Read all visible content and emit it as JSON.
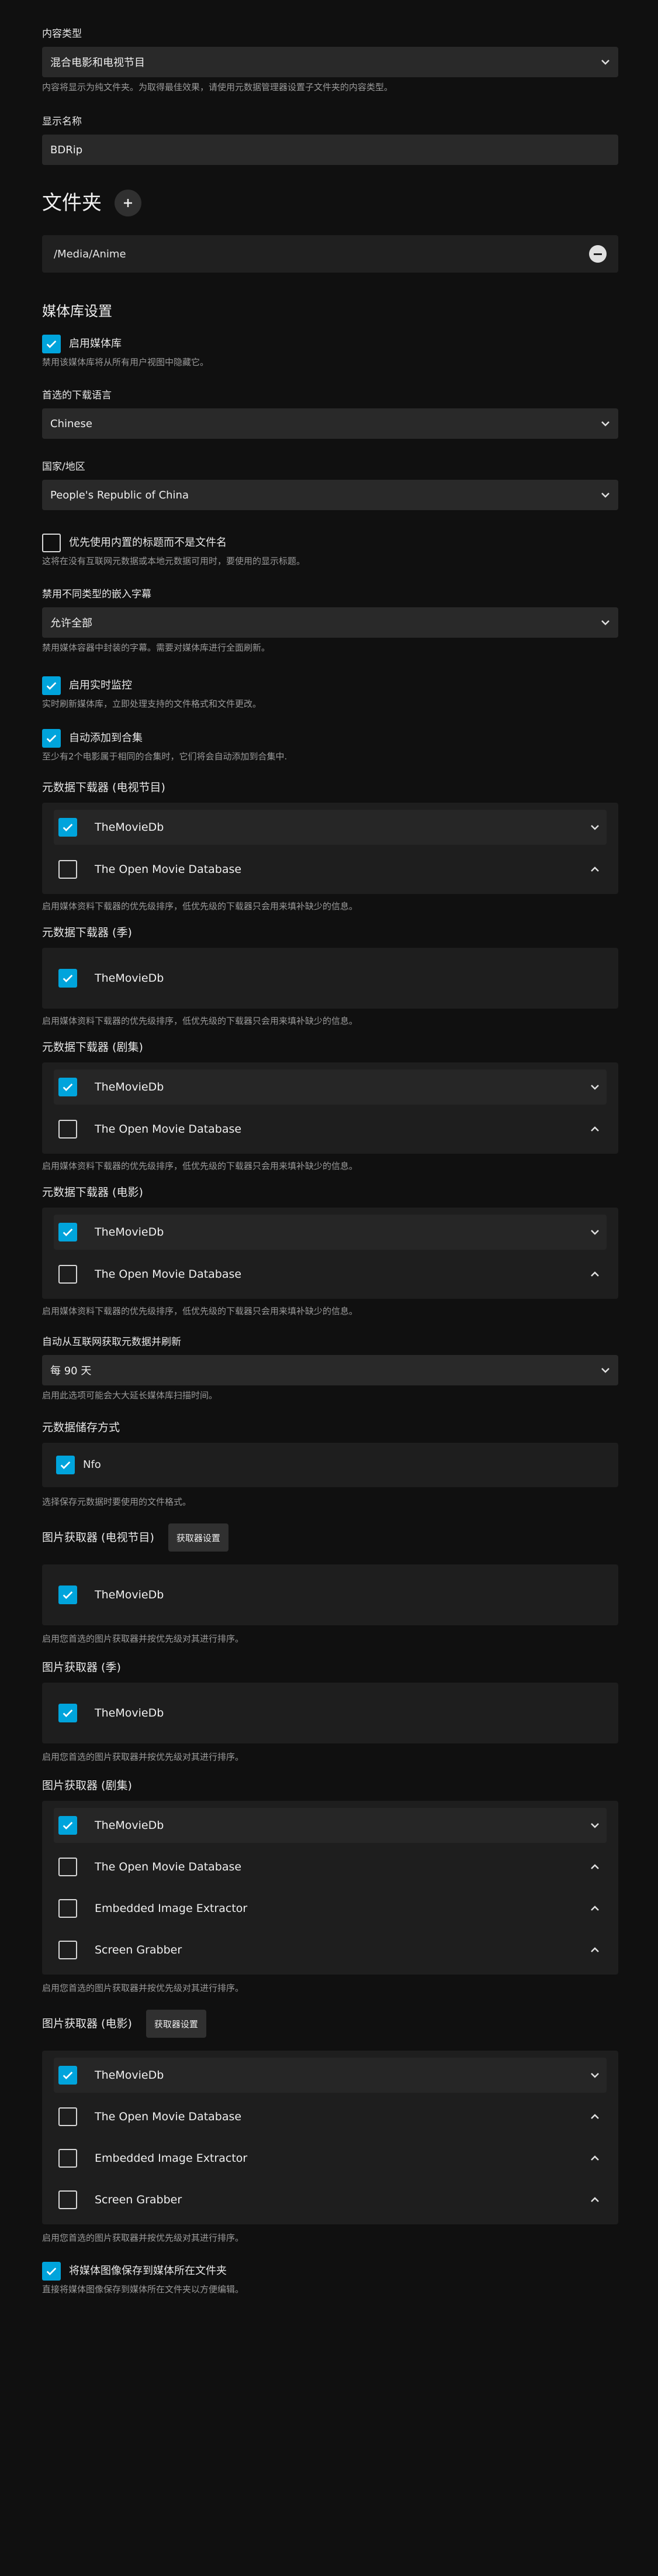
{
  "content_type": {
    "label": "内容类型",
    "value": "混合电影和电视节目",
    "help": "内容将显示为纯文件夹。为取得最佳效果，请使用元数据管理器设置子文件夹的内容类型。"
  },
  "display_name": {
    "label": "显示名称",
    "value": "BDRip"
  },
  "folders": {
    "title": "文件夹",
    "add_icon": "plus-icon",
    "items": [
      {
        "path": "/Media/Anime"
      }
    ]
  },
  "library_settings": {
    "title": "媒体库设置",
    "enable_library": {
      "label": "启用媒体库",
      "checked": true,
      "help": "禁用该媒体库将从所有用户视图中隐藏它。"
    },
    "download_language": {
      "label": "首选的下载语言",
      "value": "Chinese"
    },
    "country": {
      "label": "国家/地区",
      "value": "People's Republic of China"
    },
    "prefer_embedded_titles": {
      "label": "优先使用内置的标题而不是文件名",
      "checked": false,
      "help": "这将在没有互联网元数据或本地元数据可用时，要使用的显示标题。"
    },
    "disable_embedded_subs": {
      "label": "禁用不同类型的嵌入字幕",
      "value": "允许全部",
      "help": "禁用媒体容器中封装的字幕。需要对媒体库进行全面刷新。"
    },
    "realtime_monitor": {
      "label": "启用实时监控",
      "checked": true,
      "help": "实时刷新媒体库，立即处理支持的文件格式和文件更改。"
    },
    "auto_collections": {
      "label": "自动添加到合集",
      "checked": true,
      "help": "至少有2个电影属于相同的合集时，它们将会自动添加到合集中."
    }
  },
  "metadata_tv": {
    "title": "元数据下载器 (电视节目)",
    "items": [
      {
        "name": "TheMovieDb",
        "checked": true,
        "arrow": "down"
      },
      {
        "name": "The Open Movie Database",
        "checked": false,
        "arrow": "up"
      }
    ],
    "help": "启用媒体资料下载器的优先级排序，低优先级的下载器只会用来填补缺少的信息。"
  },
  "metadata_season": {
    "title": "元数据下载器 (季)",
    "items": [
      {
        "name": "TheMovieDb",
        "checked": true
      }
    ],
    "help": "启用媒体资料下载器的优先级排序，低优先级的下载器只会用来填补缺少的信息。"
  },
  "metadata_episode": {
    "title": "元数据下载器 (剧集)",
    "items": [
      {
        "name": "TheMovieDb",
        "checked": true,
        "arrow": "down"
      },
      {
        "name": "The Open Movie Database",
        "checked": false,
        "arrow": "up"
      }
    ],
    "help": "启用媒体资料下载器的优先级排序，低优先级的下载器只会用来填补缺少的信息。"
  },
  "metadata_movie": {
    "title": "元数据下载器 (电影)",
    "items": [
      {
        "name": "TheMovieDb",
        "checked": true,
        "arrow": "down"
      },
      {
        "name": "The Open Movie Database",
        "checked": false,
        "arrow": "up"
      }
    ],
    "help": "启用媒体资料下载器的优先级排序，低优先级的下载器只会用来填补缺少的信息。"
  },
  "auto_refresh": {
    "label": "自动从互联网获取元数据并刷新",
    "value": "每 90 天",
    "help": "启用此选项可能会大大延长媒体库扫描时间。"
  },
  "metadata_savers": {
    "title": "元数据储存方式",
    "items": [
      {
        "name": "Nfo",
        "checked": true
      }
    ],
    "help": "选择保存元数据时要使用的文件格式。"
  },
  "image_tv": {
    "title": "图片获取器 (电视节目)",
    "button": "获取器设置",
    "items": [
      {
        "name": "TheMovieDb",
        "checked": true
      }
    ],
    "help": "启用您首选的图片获取器并按优先级对其进行排序。"
  },
  "image_season": {
    "title": "图片获取器 (季)",
    "items": [
      {
        "name": "TheMovieDb",
        "checked": true
      }
    ],
    "help": "启用您首选的图片获取器并按优先级对其进行排序。"
  },
  "image_episode": {
    "title": "图片获取器 (剧集)",
    "items": [
      {
        "name": "TheMovieDb",
        "checked": true,
        "arrow": "down"
      },
      {
        "name": "The Open Movie Database",
        "checked": false,
        "arrow": "up"
      },
      {
        "name": "Embedded Image Extractor",
        "checked": false,
        "arrow": "up"
      },
      {
        "name": "Screen Grabber",
        "checked": false,
        "arrow": "up"
      }
    ],
    "help": "启用您首选的图片获取器并按优先级对其进行排序。"
  },
  "image_movie": {
    "title": "图片获取器 (电影)",
    "button": "获取器设置",
    "items": [
      {
        "name": "TheMovieDb",
        "checked": true,
        "arrow": "down"
      },
      {
        "name": "The Open Movie Database",
        "checked": false,
        "arrow": "up"
      },
      {
        "name": "Embedded Image Extractor",
        "checked": false,
        "arrow": "up"
      },
      {
        "name": "Screen Grabber",
        "checked": false,
        "arrow": "up"
      }
    ],
    "help": "启用您首选的图片获取器并按优先级对其进行排序。"
  },
  "save_artwork": {
    "label": "将媒体图像保存到媒体所在文件夹",
    "checked": true,
    "help": "直接将媒体图像保存到媒体所在文件夹以方便编辑。"
  },
  "colors": {
    "accent": "#00a4dc",
    "background": "#101010",
    "field": "#292929",
    "panel": "#1e1e1e"
  }
}
